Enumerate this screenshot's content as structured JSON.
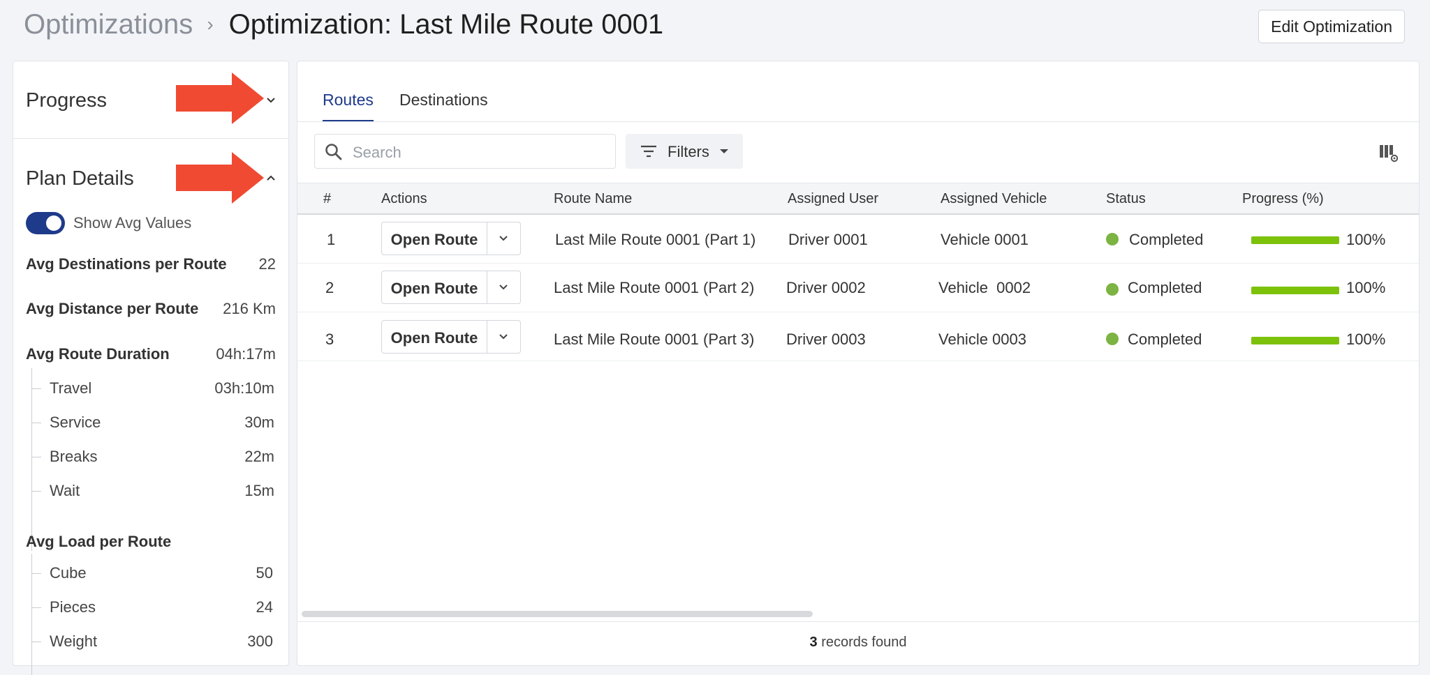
{
  "breadcrumb": {
    "root": "Optimizations",
    "separator": "›",
    "current": "Optimization: Last Mile Route 0001"
  },
  "header": {
    "edit_label": "Edit Optimization"
  },
  "left_panel": {
    "progress": {
      "title": "Progress",
      "icon": "chevron-down-icon"
    },
    "plan_details": {
      "title": "Plan Details",
      "icon": "chevron-up-icon",
      "toggle": {
        "label": "Show Avg Values",
        "on": true
      },
      "stats": [
        {
          "label": "Avg Destinations per Route",
          "value": "22"
        },
        {
          "label": "Avg Distance per Route",
          "value": "216 Km"
        },
        {
          "label": "Avg Route Duration",
          "value": "04h:17m"
        }
      ],
      "duration_breakdown": [
        {
          "label": "Travel",
          "value": "03h:10m"
        },
        {
          "label": "Service",
          "value": "30m"
        },
        {
          "label": "Breaks",
          "value": "22m"
        },
        {
          "label": "Wait",
          "value": "15m"
        }
      ],
      "load_title": "Avg Load per Route",
      "load_breakdown": [
        {
          "label": "Cube",
          "value": "50"
        },
        {
          "label": "Pieces",
          "value": "24"
        },
        {
          "label": "Weight",
          "value": "300"
        }
      ]
    }
  },
  "annotation": {
    "arrow_color": "#f04a32"
  },
  "main": {
    "tabs": [
      {
        "label": "Routes",
        "active": true
      },
      {
        "label": "Destinations",
        "active": false
      }
    ],
    "search": {
      "placeholder": "Search"
    },
    "filters_label": "Filters",
    "columns": [
      "#",
      "Actions",
      "Route Name",
      "Assigned User",
      "Assigned Vehicle",
      "Status",
      "Progress (%)"
    ],
    "rows": [
      {
        "num": "1",
        "action": "Open Route",
        "route": "Last Mile Route 0001 (Part 1)",
        "user": "Driver 0001",
        "vehicle": "Vehicle 0001",
        "status": "Completed",
        "progress": 100,
        "progress_label": "100%"
      },
      {
        "num": "2",
        "action": "Open Route",
        "route": "Last Mile Route 0001 (Part 2)",
        "user": "Driver 0002",
        "vehicle": "Vehicle  0002",
        "status": "Completed",
        "progress": 100,
        "progress_label": "100%"
      },
      {
        "num": "3",
        "action": "Open Route",
        "route": "Last Mile Route 0001 (Part 3)",
        "user": "Driver 0003",
        "vehicle": "Vehicle 0003",
        "status": "Completed",
        "progress": 100,
        "progress_label": "100%"
      }
    ],
    "footer": {
      "count": "3",
      "text": "records found"
    }
  },
  "colors": {
    "accent": "#1e3a8a",
    "status_completed": "#7cb342",
    "progress_fill": "#7cc20b"
  }
}
